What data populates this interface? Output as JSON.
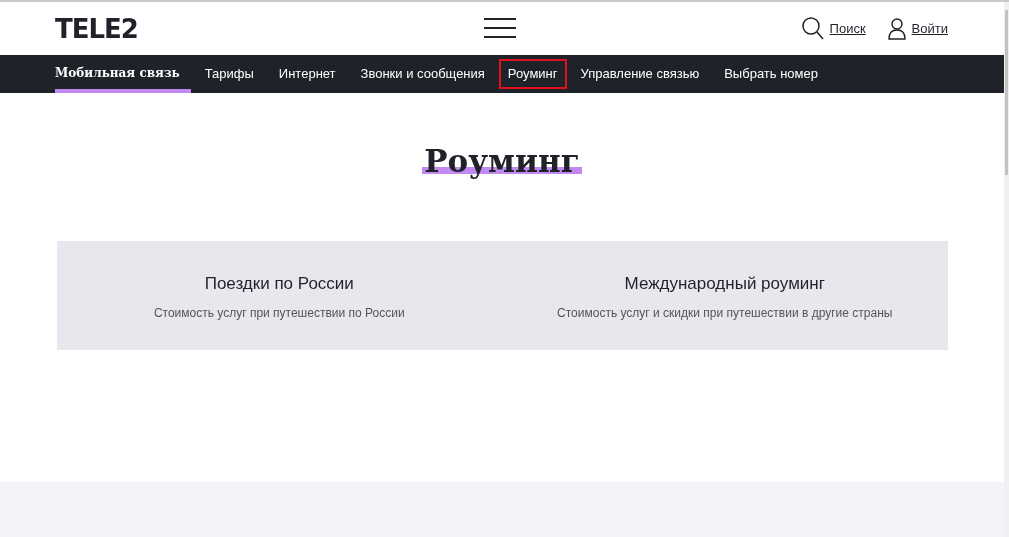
{
  "header": {
    "logo": "TELE2",
    "search_link": "Поиск",
    "login_link": "Войти"
  },
  "nav": [
    {
      "label": "Мобильная связь",
      "selected": true,
      "highlighted": false
    },
    {
      "label": "Тарифы",
      "selected": false,
      "highlighted": false
    },
    {
      "label": "Интернет",
      "selected": false,
      "highlighted": false
    },
    {
      "label": "Звонки и сообщения",
      "selected": false,
      "highlighted": false
    },
    {
      "label": "Роуминг",
      "selected": false,
      "highlighted": true
    },
    {
      "label": "Управление связью",
      "selected": false,
      "highlighted": false
    },
    {
      "label": "Выбрать номер",
      "selected": false,
      "highlighted": false
    }
  ],
  "page_title": "Роуминг",
  "options": [
    {
      "title": "Поездки по России",
      "subtitle": "Стоимость услуг при путешествии по России"
    },
    {
      "title": "Международный роуминг",
      "subtitle": "Стоимость услуг и скидки при путешествии в другие страны"
    }
  ]
}
